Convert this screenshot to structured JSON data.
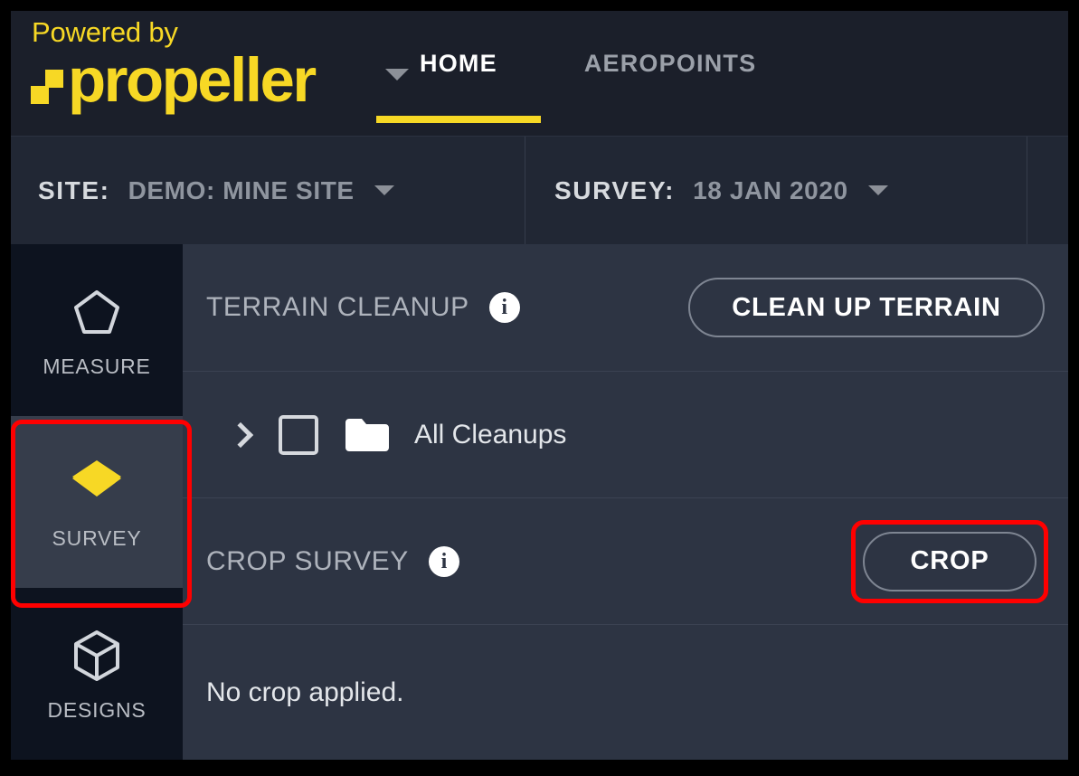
{
  "brand": {
    "powered_by": "Powered by",
    "name": "propeller",
    "logo_icon": "propeller-squares-logo",
    "dropdown_icon": "chevron-down-icon",
    "accent_color": "#f7d825"
  },
  "nav": {
    "tabs": [
      {
        "label": "HOME",
        "active": true
      },
      {
        "label": "AEROPOINTS",
        "active": false
      }
    ]
  },
  "selector_bar": {
    "site": {
      "label": "SITE:",
      "value": "DEMO: MINE SITE",
      "caret_icon": "chevron-down-icon"
    },
    "survey": {
      "label": "SURVEY:",
      "value": "18 JAN 2020",
      "caret_icon": "chevron-down-icon"
    }
  },
  "sidebar": {
    "items": [
      {
        "label": "MEASURE",
        "icon": "pentagon-icon",
        "selected": false
      },
      {
        "label": "SURVEY",
        "icon": "layers-icon",
        "selected": true
      },
      {
        "label": "DESIGNS",
        "icon": "cube-icon",
        "selected": false
      }
    ]
  },
  "panel": {
    "terrain_cleanup": {
      "title": "TERRAIN CLEANUP",
      "info_icon": "info-icon",
      "info_glyph": "i",
      "button_label": "CLEAN UP TERRAIN"
    },
    "cleanups_row": {
      "expand_icon": "chevron-right-icon",
      "checkbox_icon": "checkbox-unchecked-icon",
      "folder_icon": "folder-icon",
      "label": "All Cleanups"
    },
    "crop_survey": {
      "title": "CROP SURVEY",
      "info_icon": "info-icon",
      "info_glyph": "i",
      "button_label": "CROP"
    },
    "crop_status": "No crop applied."
  },
  "annotations": {
    "highlight_color": "#ff0000",
    "targets": [
      "sidebar-item-survey",
      "crop-button"
    ]
  }
}
